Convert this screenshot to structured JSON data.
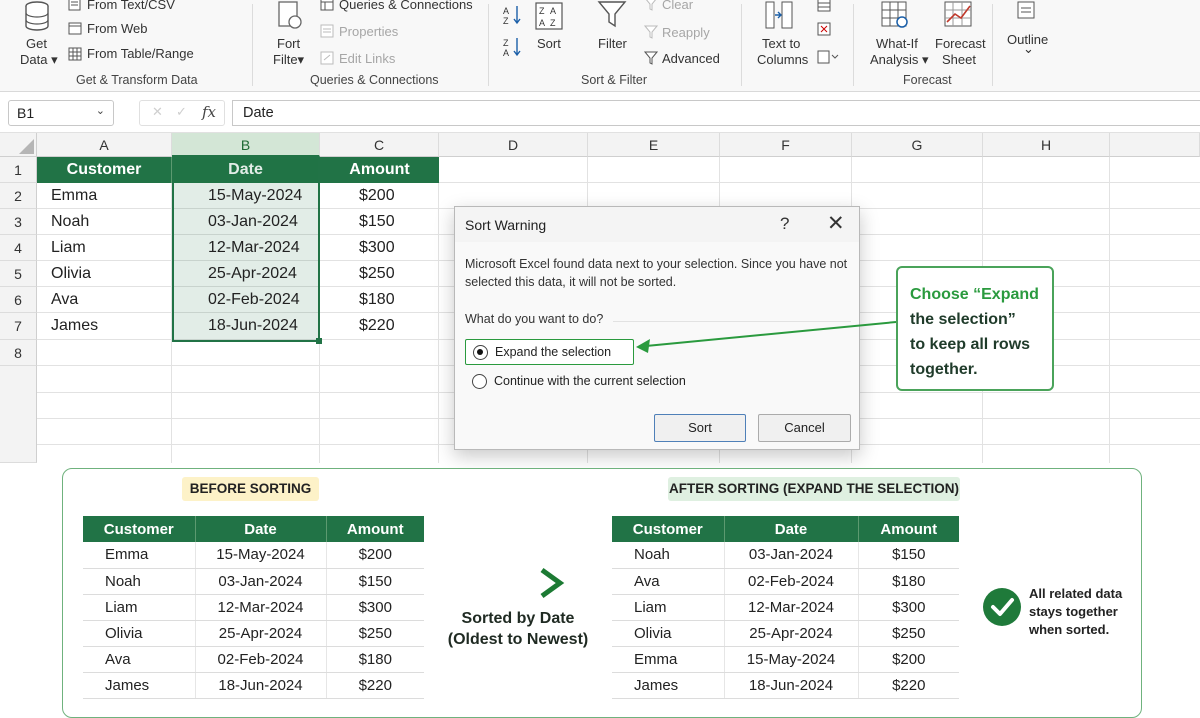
{
  "ribbon": {
    "get_data": {
      "line1": "Get",
      "line2": "Data ▾"
    },
    "from_text_csv": "From Text/CSV",
    "from_web": "From Web",
    "from_table_range": "From Table/Range",
    "group_get_transform": "Get & Transform Data",
    "refresh_all": {
      "line1": "Fort",
      "line2": "Filte▾"
    },
    "queries_connections": "Queries & Connections",
    "properties": "Properties",
    "edit_links": "Edit Links",
    "group_queries": "Queries & Connections",
    "sort_label": "Sort",
    "filter_label": "Filter",
    "clear": "Clear",
    "reapply": "Reapply",
    "advanced": "Advanced",
    "group_sort_filter": "Sort & Filter",
    "text_to_columns": {
      "line1": "Text to",
      "line2": "Columns"
    },
    "what_if": {
      "line1": "What-If",
      "line2": "Analysis ▾"
    },
    "forecast_sheet": {
      "line1": "Forecast",
      "line2": "Sheet"
    },
    "group_forecast": "Forecast",
    "outline": "Outline",
    "outline_chevron": "⌄"
  },
  "formula_bar": {
    "name_box": "B1",
    "fx": "fx",
    "value": "Date"
  },
  "sheet": {
    "columns": [
      "A",
      "B",
      "C",
      "D",
      "E",
      "F",
      "G",
      "H"
    ],
    "rows": [
      "1",
      "2",
      "3",
      "4",
      "5",
      "6",
      "7",
      "8"
    ],
    "headers": [
      "Customer",
      "Date",
      "Amount"
    ],
    "data": [
      [
        "Emma",
        "15-May-2024",
        "$200"
      ],
      [
        "Noah",
        "03-Jan-2024",
        "$150"
      ],
      [
        "Liam",
        "12-Mar-2024",
        "$300"
      ],
      [
        "Olivia",
        "25-Apr-2024",
        "$250"
      ],
      [
        "Ava",
        "02-Feb-2024",
        "$180"
      ],
      [
        "James",
        "18-Jun-2024",
        "$220"
      ]
    ]
  },
  "dialog": {
    "title": "Sort Warning",
    "help": "?",
    "close": "✕",
    "message": "Microsoft Excel found data next to your selection. Since you have not selected this data, it will not be sorted.",
    "question": "What do you want to do?",
    "option_expand": "Expand the selection",
    "option_continue": "Continue with the current selection",
    "sort_button": "Sort",
    "cancel_button": "Cancel"
  },
  "callout": {
    "line1": "Choose “Expand",
    "line2": "the selection”",
    "line3": "to keep all rows",
    "line4": "together."
  },
  "comparison": {
    "before_title": "BEFORE SORTING",
    "after_title": "AFTER SORTING (EXPAND THE SELECTION)",
    "headers": [
      "Customer",
      "Date",
      "Amount"
    ],
    "before_rows": [
      [
        "Emma",
        "15-May-2024",
        "$200"
      ],
      [
        "Noah",
        "03-Jan-2024",
        "$150"
      ],
      [
        "Liam",
        "12-Mar-2024",
        "$300"
      ],
      [
        "Olivia",
        "25-Apr-2024",
        "$250"
      ],
      [
        "Ava",
        "02-Feb-2024",
        "$180"
      ],
      [
        "James",
        "18-Jun-2024",
        "$220"
      ]
    ],
    "after_rows": [
      [
        "Noah",
        "03-Jan-2024",
        "$150"
      ],
      [
        "Ava",
        "02-Feb-2024",
        "$180"
      ],
      [
        "Liam",
        "12-Mar-2024",
        "$300"
      ],
      [
        "Olivia",
        "25-Apr-2024",
        "$250"
      ],
      [
        "Emma",
        "15-May-2024",
        "$200"
      ],
      [
        "James",
        "18-Jun-2024",
        "$220"
      ]
    ],
    "arrow_line1": "Sorted by Date",
    "arrow_line2": "(Oldest to Newest)",
    "note_line1": "All related data",
    "note_line2": "stays together",
    "note_line3": "when sorted."
  },
  "colors": {
    "excel_green": "#217346",
    "accent_green": "#2a9a3e",
    "before_pill": "#fdf2c8",
    "after_pill": "#dff0e1"
  }
}
